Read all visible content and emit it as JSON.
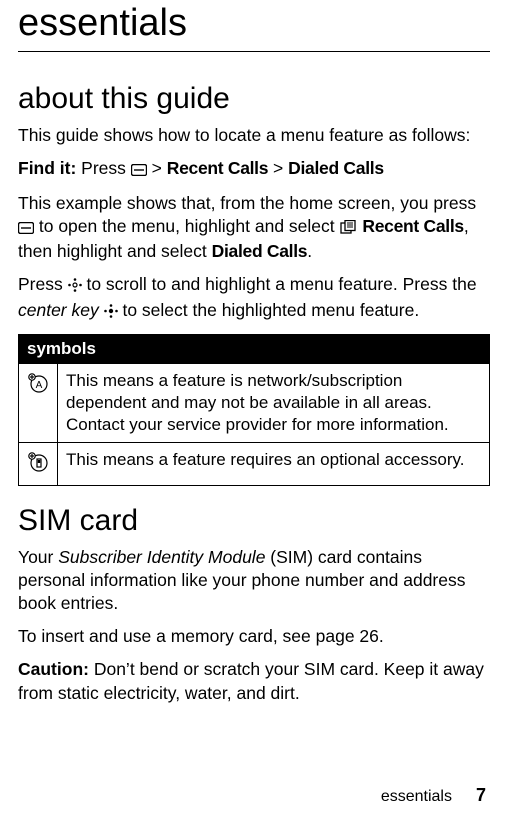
{
  "title": "essentials",
  "section1": {
    "heading": "about this guide",
    "intro": "This guide shows how to locate a menu feature as follows:",
    "findit_label": "Find it:",
    "findit_press": " Press ",
    "gt": " > ",
    "recent_calls": "Recent Calls",
    "dialed_calls": "Dialed Calls",
    "example_a": "This example shows that, from the home screen, you press ",
    "example_b": " to open the menu, highlight and select ",
    "example_c": ", then highlight and select ",
    "example_d": ".",
    "press_a": "Press ",
    "press_b": " to scroll to and highlight a menu feature. Press the ",
    "center_key": "center key",
    "press_c": " to select the highlighted menu feature."
  },
  "symbols": {
    "header": "symbols",
    "rows": [
      "This means a feature is network/subscription dependent and may not be available in all areas. Contact your service provider for more information.",
      "This means a feature requires an optional accessory."
    ]
  },
  "section2": {
    "heading": "SIM card",
    "p1a": "Your ",
    "p1b": "Subscriber Identity Module",
    "p1c": " (SIM) card contains personal information like your phone number and address book entries.",
    "p2": "To insert and use a memory card, see page 26.",
    "p3a": "Caution:",
    "p3b": " Don’t bend or scratch your SIM card. Keep it away from static electricity, water, and dirt."
  },
  "footer": {
    "label": "essentials",
    "page": "7"
  }
}
